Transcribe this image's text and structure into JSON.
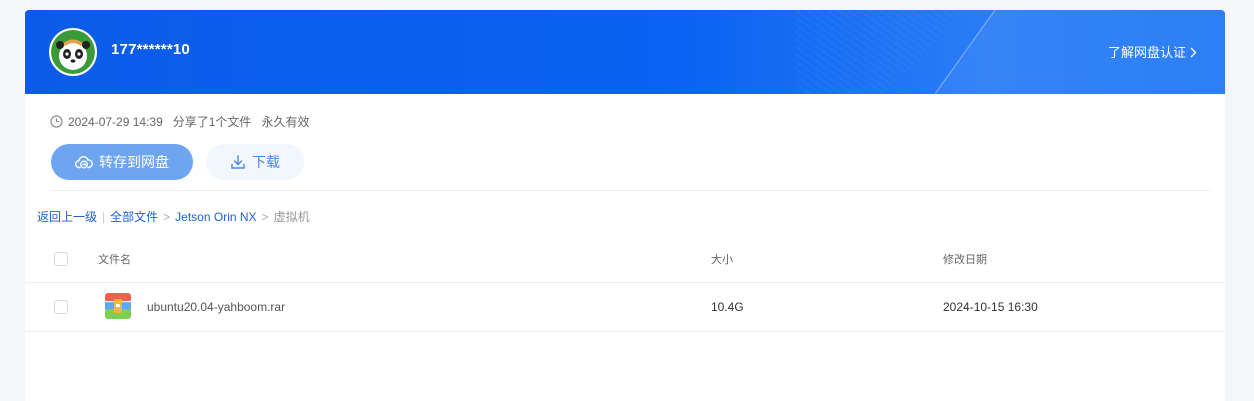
{
  "header": {
    "username": "177******10",
    "cert_link": "了解网盘认证"
  },
  "meta": {
    "datetime": "2024-07-29 14:39",
    "shared": "分享了1个文件",
    "validity": "永久有效"
  },
  "actions": {
    "save_label": "转存到网盘",
    "download_label": "下载"
  },
  "breadcrumb": {
    "back": "返回上一级",
    "all_files": "全部文件",
    "folder": "Jetson Orin NX",
    "current": "虚拟机"
  },
  "table": {
    "columns": {
      "name": "文件名",
      "size": "大小",
      "modified": "修改日期"
    },
    "rows": [
      {
        "name": "ubuntu20.04-yahboom.rar",
        "size": "10.4G",
        "modified": "2024-10-15 16:30"
      }
    ]
  },
  "icons": {
    "avatar": "panda-avatar",
    "clock": "clock-icon",
    "save": "cloud-upload-icon",
    "download": "download-icon",
    "file": "rar-archive-icon",
    "chevron": "chevron-right-icon"
  },
  "colors": {
    "header_blue": "#0b5be8",
    "save_button": "#6da5f0",
    "link_blue": "#1d5fd6"
  }
}
